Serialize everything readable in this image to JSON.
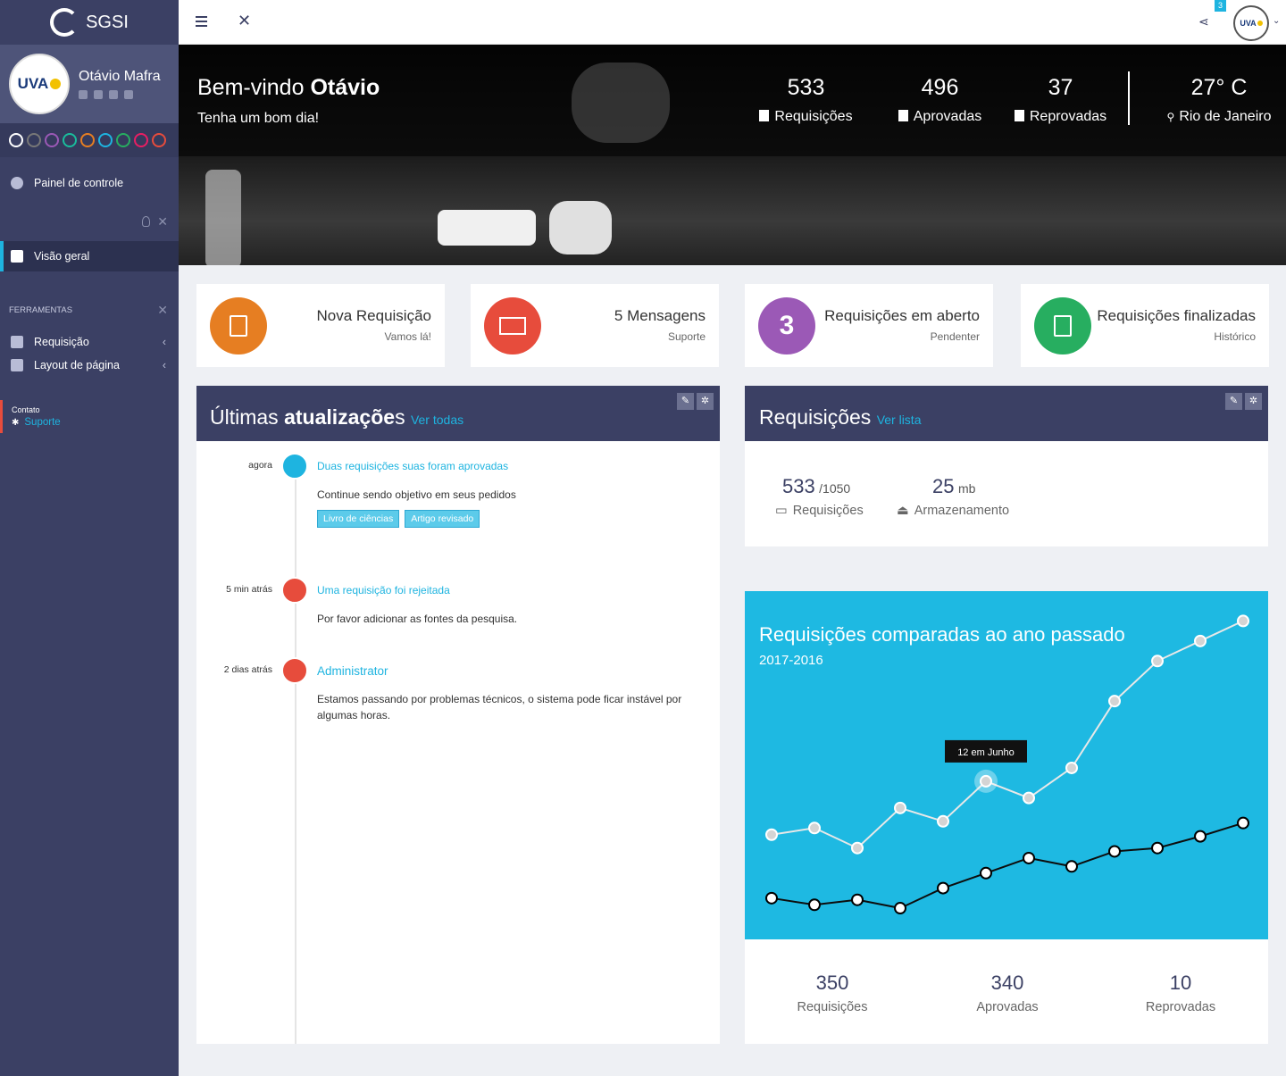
{
  "app": {
    "name": "SGSI"
  },
  "user": {
    "name": "Otávio Mafra",
    "avatar_text": "UVA"
  },
  "themes": [
    "#ffffff",
    "#777777",
    "#9b59b6",
    "#1abc9c",
    "#e67e22",
    "#1eb4e0",
    "#27ae60",
    "#e91e63",
    "#e74c3c"
  ],
  "sidebar": {
    "dashboard": "Painel de controle",
    "overview": "Visão geral",
    "tools_label": "FERRAMENTAS",
    "tools": [
      "Requisição",
      "Layout de página"
    ],
    "contact_label": "Contato",
    "support": "Suporte"
  },
  "topbar": {
    "badge": "3",
    "avatar_text": "UVA"
  },
  "hero": {
    "welcome": "Bem-vindo",
    "name": "Otávio",
    "greeting": "Tenha um bom dia!",
    "stats": [
      {
        "value": "533",
        "label": "Requisições",
        "icon": "file-icon"
      },
      {
        "value": "496",
        "label": "Aprovadas",
        "icon": "thumbs-up-icon"
      },
      {
        "value": "37",
        "label": "Reprovadas",
        "icon": "thumbs-down-icon"
      }
    ],
    "weather": {
      "temp": "27° C",
      "city": "Rio de Janeiro"
    }
  },
  "tiles": [
    {
      "title": "Nova Requisição",
      "sub": "Vamos lá!",
      "color": "#e67e22",
      "icon": "document-icon"
    },
    {
      "title": "5 Mensagens",
      "sub": "Suporte",
      "color": "#e74c3c",
      "icon": "envelope-icon"
    },
    {
      "title": "Requisições em aberto",
      "sub": "Pendenter",
      "color": "#9b59b6",
      "badge": "3"
    },
    {
      "title": "Requisições finalizadas",
      "sub": "Histórico",
      "color": "#27ae60",
      "icon": "box-icon"
    }
  ],
  "updates": {
    "title_light": "Últimas",
    "title_bold": "atualizaçõe",
    "title_tail": "s",
    "link": "Ver todas",
    "items": [
      {
        "time": "agora",
        "title": "Duas requisições suas foram aprovadas",
        "text": "Continue sendo objetivo em seus pedidos",
        "color": "#1eb4e0",
        "tags": [
          "Livro de ciências",
          "Artigo  revisado"
        ]
      },
      {
        "time": "5 min atrás",
        "title": "Uma requisição foi rejeitada",
        "text": "Por favor adicionar as fontes da pesquisa.",
        "color": "#e74c3c"
      },
      {
        "time": "2 dias atrás",
        "title": "Administrator",
        "text": "Estamos passando por problemas técnicos, o sistema pode ficar instável por algumas horas.",
        "color": "#e74c3c"
      }
    ]
  },
  "requests": {
    "title": "Requisições",
    "link": "Ver lista",
    "count": "533",
    "total": "/1050",
    "count_label": "Requisições",
    "storage": "25",
    "storage_unit": "mb",
    "storage_label": "Armazenamento"
  },
  "chart_data": {
    "type": "line",
    "title": "Requisições comparadas ao ano passado",
    "subtitle": "2017-2016",
    "tooltip": "12 em Junho",
    "categories": [
      "1",
      "2",
      "3",
      "4",
      "5",
      "6",
      "7",
      "8",
      "9",
      "10",
      "11",
      "12"
    ],
    "series": [
      {
        "color": "#e8e8e8",
        "values": [
          26,
          28,
          22,
          34,
          30,
          42,
          37,
          46,
          66,
          78,
          84,
          90
        ]
      },
      {
        "color": "#0d0d0d",
        "values": [
          7,
          5,
          6.5,
          4,
          10,
          14.5,
          19,
          16.5,
          21,
          22,
          25.5,
          29.5
        ]
      }
    ],
    "highlight_index": 5,
    "ylim": [
      0,
      100
    ]
  },
  "summary": [
    {
      "value": "350",
      "label": "Requisições"
    },
    {
      "value": "340",
      "label": "Aprovadas"
    },
    {
      "value": "10",
      "label": "Reprovadas"
    }
  ]
}
